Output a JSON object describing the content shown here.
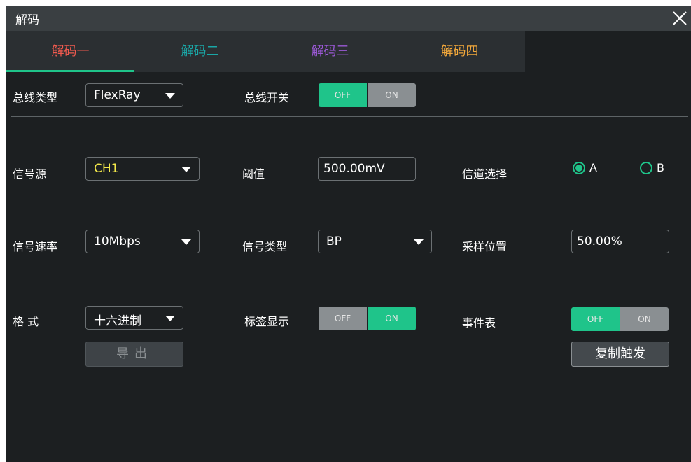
{
  "dialog": {
    "title": "解码"
  },
  "tabs": [
    {
      "label": "解码一",
      "color": "#f05a4f"
    },
    {
      "label": "解码二",
      "color": "#1aa7a7"
    },
    {
      "label": "解码三",
      "color": "#9b59d6"
    },
    {
      "label": "解码四",
      "color": "#f3a83b"
    }
  ],
  "bus": {
    "type_label": "总线类型",
    "type_value": "FlexRay",
    "switch_label": "总线开关",
    "switch_off": "OFF",
    "switch_on": "ON",
    "switch_state": "OFF"
  },
  "signal": {
    "source_label": "信号源",
    "source_value": "CH1",
    "source_color": "#f4e94a",
    "threshold_label": "阈值",
    "threshold_value": "500.00mV",
    "channel_label": "信道选择",
    "channel_options": [
      "A",
      "B"
    ],
    "channel_selected": "A",
    "rate_label": "信号速率",
    "rate_value": "10Mbps",
    "signal_type_label": "信号类型",
    "signal_type_value": "BP",
    "sample_label": "采样位置",
    "sample_value": "50.00%"
  },
  "format": {
    "label": "格 式",
    "value": "十六进制",
    "tag_label": "标签显示",
    "tag_off": "OFF",
    "tag_on": "ON",
    "tag_state": "ON",
    "event_label": "事件表",
    "event_off": "OFF",
    "event_on": "ON",
    "event_state": "OFF",
    "export_label": "导出",
    "copy_trigger_label": "复制触发"
  }
}
